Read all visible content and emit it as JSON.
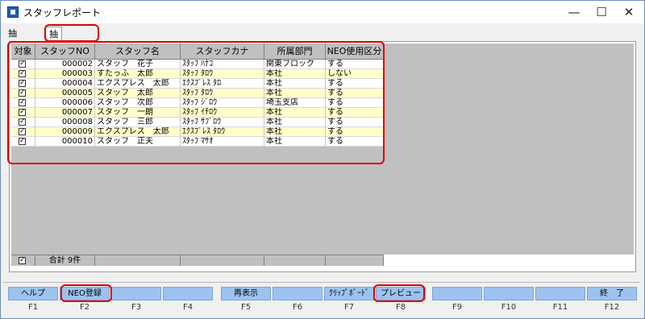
{
  "window": {
    "title": "スタッフレポート",
    "minimize": "—",
    "maximize": "☐",
    "close": "✕",
    "icon": "app-icon"
  },
  "tabs": [
    {
      "label": "抽出条件"
    },
    {
      "label": "抽出結果"
    }
  ],
  "grid": {
    "headers": [
      "対象",
      "スタッフNO",
      "スタッフ名",
      "スタッフカナ",
      "所属部門",
      "NEO使用区分"
    ],
    "rows": [
      {
        "checked": true,
        "no": "000002",
        "name": "スタッフ　花子",
        "kana": "ｽﾀｯﾌ ﾊﾅｺ",
        "dept": "関東ブロック",
        "neo": "する"
      },
      {
        "checked": true,
        "no": "000003",
        "name": "すたっふ　太郎",
        "kana": "ｽﾀｯﾌ ﾀﾛｳ",
        "dept": "本社",
        "neo": "しない"
      },
      {
        "checked": true,
        "no": "000004",
        "name": "エクスプレス　太郎",
        "kana": "ｴｸｽﾌﾟﾚｽ ﾀﾛ",
        "dept": "本社",
        "neo": "する"
      },
      {
        "checked": true,
        "no": "000005",
        "name": "スタッフ　太郎",
        "kana": "ｽﾀｯﾌ ﾀﾛｳ",
        "dept": "本社",
        "neo": "する"
      },
      {
        "checked": true,
        "no": "000006",
        "name": "スタッフ　次郎",
        "kana": "ｽﾀｯﾌ ｼﾞﾛｳ",
        "dept": "埼玉支店",
        "neo": "する"
      },
      {
        "checked": true,
        "no": "000007",
        "name": "スタッフ　一朗",
        "kana": "ｽﾀｯﾌ ｲﾁﾛｳ",
        "dept": "本社",
        "neo": "する"
      },
      {
        "checked": true,
        "no": "000008",
        "name": "スタッフ　三郎",
        "kana": "ｽﾀｯﾌ ｻﾌﾞﾛｳ",
        "dept": "本社",
        "neo": "する"
      },
      {
        "checked": true,
        "no": "000009",
        "name": "エクスプレス　太郎",
        "kana": "ｴｸｽﾌﾟﾚｽ ﾀﾛｳ",
        "dept": "本社",
        "neo": "する"
      },
      {
        "checked": true,
        "no": "000010",
        "name": "スタッフ　正夫",
        "kana": "ｽﾀｯﾌ ﾏｻｵ",
        "dept": "本社",
        "neo": "する"
      }
    ],
    "footer": {
      "checked": true,
      "total": "合計 9件"
    },
    "alt_row_color": "#ffffcc"
  },
  "function_keys": [
    {
      "label": "ヘルプ",
      "key": "F1"
    },
    {
      "label": "NEO登録",
      "key": "F2"
    },
    {
      "label": "",
      "key": "F3"
    },
    {
      "label": "",
      "key": "F4"
    },
    {
      "label": "再表示",
      "key": "F5"
    },
    {
      "label": "",
      "key": "F6"
    },
    {
      "label": "ｸﾘｯﾌﾟﾎﾞｰﾄﾞ",
      "key": "F7"
    },
    {
      "label": "プレビュー",
      "key": "F8"
    },
    {
      "label": "",
      "key": "F9"
    },
    {
      "label": "",
      "key": "F10"
    },
    {
      "label": "",
      "key": "F11"
    },
    {
      "label": "終　了",
      "key": "F12"
    }
  ],
  "highlight_color": "#e00000"
}
